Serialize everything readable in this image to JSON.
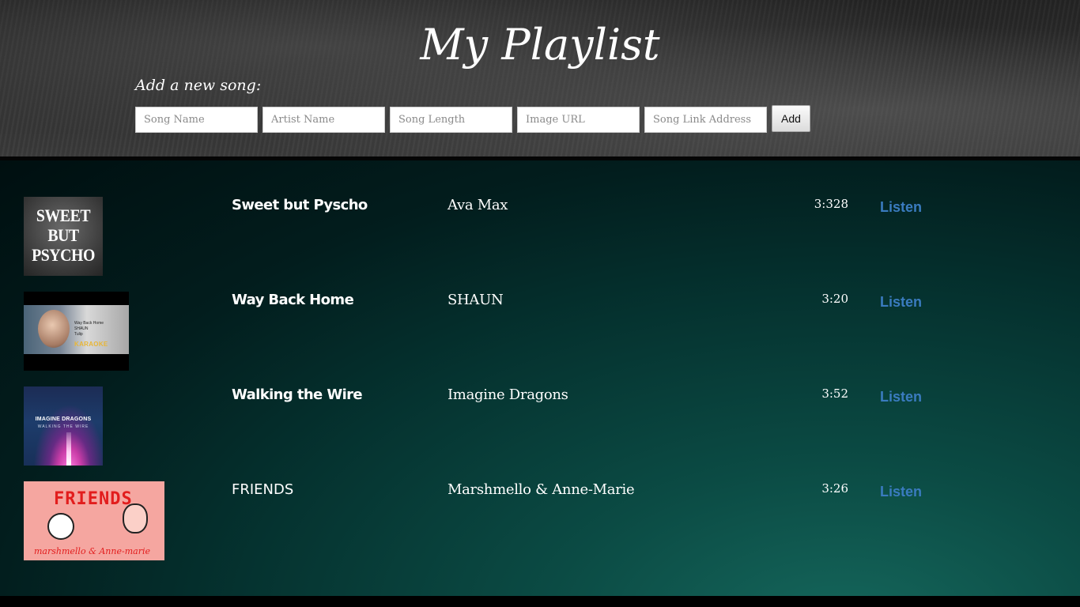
{
  "header": {
    "title": "My Playlist",
    "add_label": "Add a new song:",
    "fields": {
      "song_name_placeholder": "Song Name",
      "artist_name_placeholder": "Artist Name",
      "song_length_placeholder": "Song Length",
      "image_url_placeholder": "Image URL",
      "song_link_placeholder": "Song Link Address"
    },
    "add_button_label": "Add"
  },
  "songs": [
    {
      "title": "Sweet but Pyscho",
      "artist": "Ava Max",
      "length": "3:328",
      "listen_label": "Listen",
      "cover": {
        "lines": [
          "SWEET",
          "BUT",
          "PSYCHO"
        ]
      }
    },
    {
      "title": "Way Back Home",
      "artist": "SHAUN",
      "length": "3:20",
      "listen_label": "Listen",
      "cover": {
        "caption_1": "Way Back Home",
        "caption_2": "SHAUN",
        "caption_3": "Tulip",
        "badge": "KARAOKE"
      }
    },
    {
      "title": "Walking the Wire",
      "artist": "Imagine Dragons",
      "length": "3:52",
      "listen_label": "Listen",
      "cover": {
        "band": "IMAGINE DRAGONS",
        "subtitle": "WALKING THE WIRE"
      }
    },
    {
      "title": "FRIENDS",
      "artist": "Marshmello & Anne-Marie",
      "length": "3:26",
      "listen_label": "Listen",
      "cover": {
        "title": "FRIENDS",
        "subtitle": "marshmello & Anne-marie"
      }
    }
  ],
  "colors": {
    "link": "#3a7bbf",
    "header_bg": "#2e2e2e",
    "list_bg_dark": "#021d1d",
    "list_bg_glow": "#15675c"
  }
}
